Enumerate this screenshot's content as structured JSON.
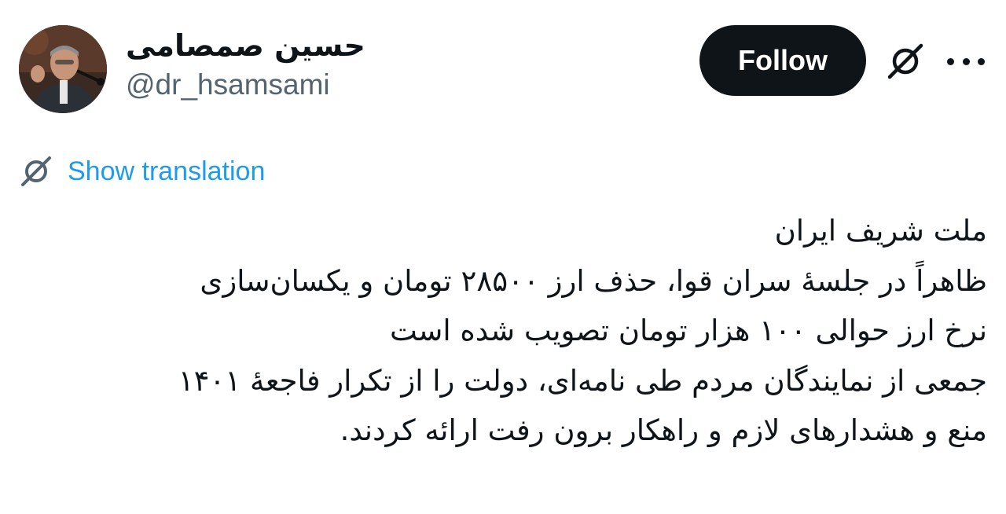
{
  "author": {
    "display_name": "حسین صمصامی",
    "handle": "@dr_hsamsami",
    "avatar": "author-photo"
  },
  "actions": {
    "follow_label": "Follow",
    "grok_icon": "grok-slash-icon",
    "more_icon": "more-dots-icon"
  },
  "translation": {
    "label": "Show translation",
    "icon": "grok-slash-icon"
  },
  "tweet": {
    "lines": [
      "ملت شریف ایران",
      "ظاهراً در جلسۀ سران قوا، حذف ارز ۲۸۵۰۰ تومان و یکسان‌سازی",
      "نرخ ارز حوالی ۱۰۰ هزار تومان تصویب شده است",
      "جمعی از نمایندگان مردم طی نامه‌ای، دولت را از تکرار فاجعۀ ۱۴۰۱",
      "منع و هشدارهای لازم و راهکار برون رفت ارائه کردند."
    ]
  },
  "colors": {
    "text": "#0f1419",
    "secondary": "#536471",
    "link": "#1d9bf0",
    "button_bg": "#0f1419",
    "button_text": "#ffffff"
  }
}
